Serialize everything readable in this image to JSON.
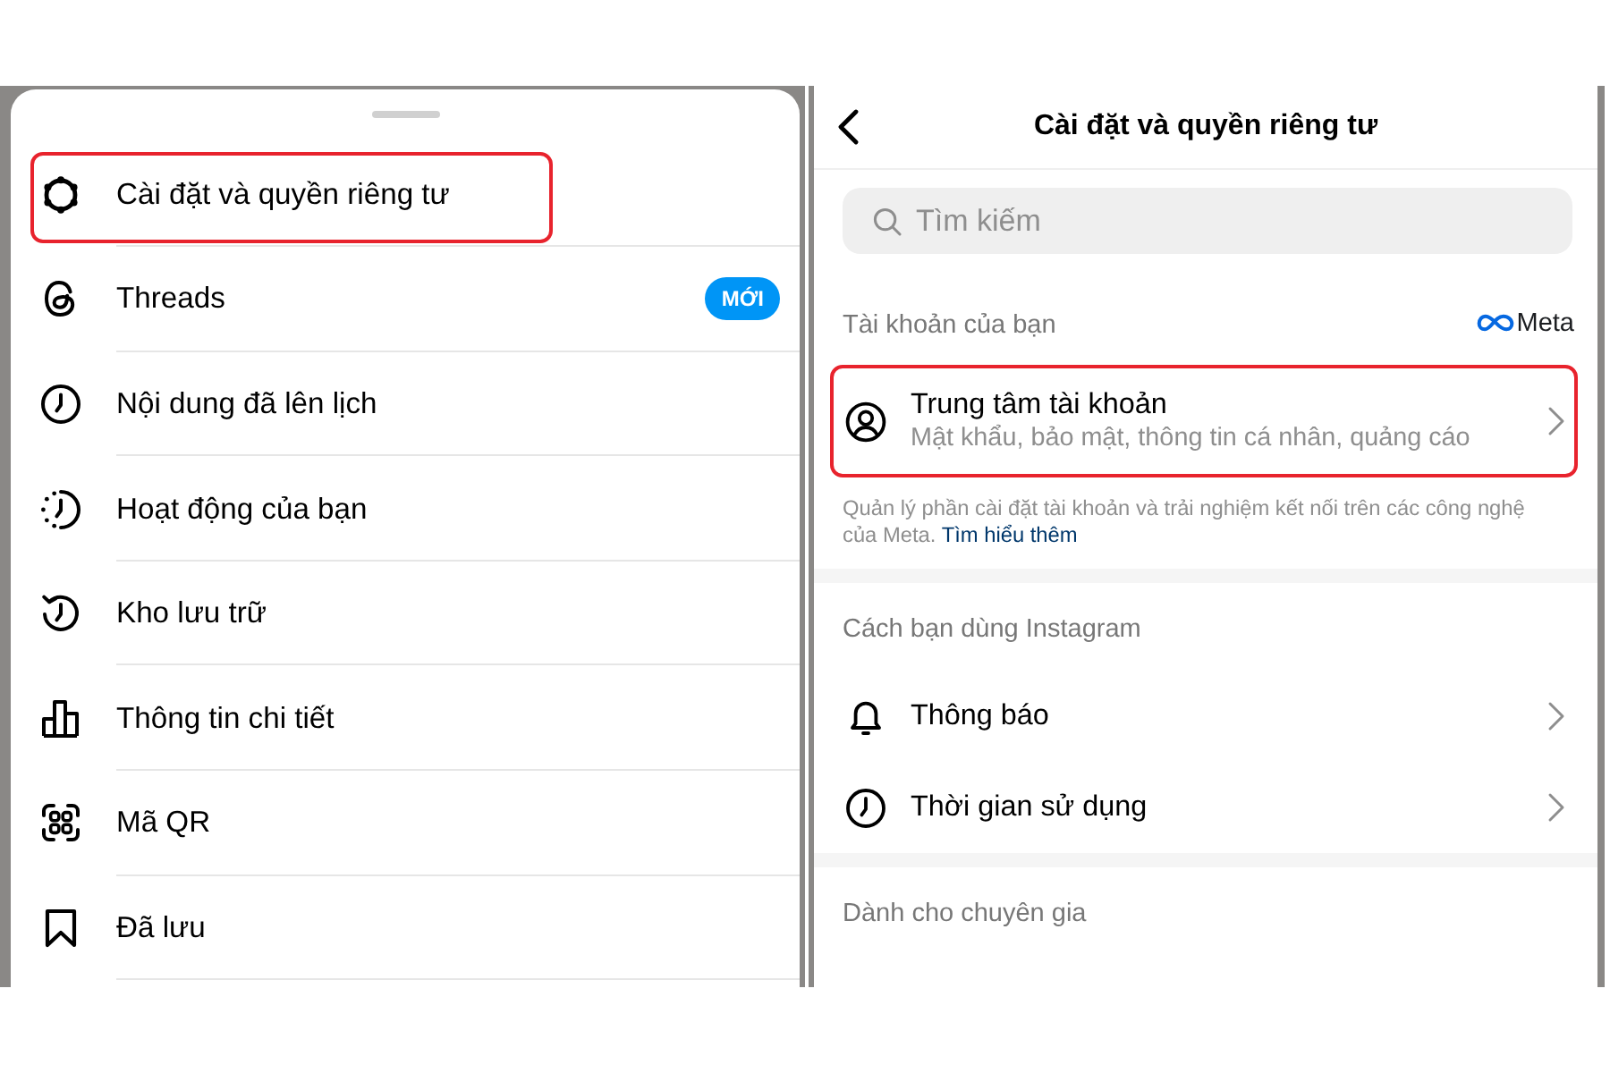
{
  "menu_sheet": {
    "items": [
      {
        "label": "Cài đặt và quyền riêng tư",
        "highlighted": true
      },
      {
        "label": "Threads",
        "badge": "MỚI",
        "highlighted": false
      },
      {
        "label": "Nội dung đã lên lịch",
        "highlighted": false
      },
      {
        "label": "Hoạt động của bạn",
        "highlighted": false
      },
      {
        "label": "Kho lưu trữ",
        "highlighted": false
      },
      {
        "label": "Thông tin chi tiết",
        "highlighted": false
      },
      {
        "label": "Mã QR",
        "highlighted": false
      },
      {
        "label": "Đã lưu",
        "highlighted": false
      }
    ]
  },
  "settings_screen": {
    "title": "Cài đặt và quyền riêng tư",
    "search": {
      "placeholder": "Tìm kiếm"
    },
    "sections": [
      {
        "heading": "Tài khoản của bạn",
        "brand": "Meta",
        "items": [
          {
            "title": "Trung tâm tài khoản",
            "subtitle": "Mật khẩu, bảo mật, thông tin cá nhân, quảng cáo",
            "highlighted": true
          }
        ],
        "note": "Quản lý phần cài đặt tài khoản và trải nghiệm kết nối trên các công nghệ của Meta.",
        "note_link": "Tìm hiểu thêm"
      },
      {
        "heading": "Cách bạn dùng Instagram",
        "items": [
          {
            "title": "Thông báo",
            "highlighted": false
          },
          {
            "title": "Thời gian sử dụng",
            "highlighted": false
          }
        ]
      },
      {
        "heading": "Dành cho chuyên gia"
      }
    ]
  }
}
